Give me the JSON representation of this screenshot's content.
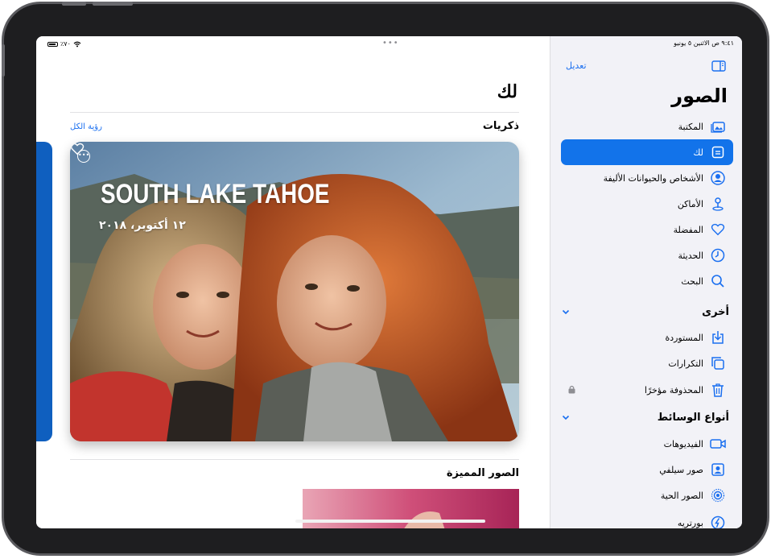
{
  "status": {
    "left_battery": "٪٧٠",
    "right_time": "٩:٤١ ص",
    "right_date": "الاثنين ٥ يونيو"
  },
  "main": {
    "title": "لك",
    "memories_title": "ذكريات",
    "see_all": "رؤية الكل",
    "card": {
      "title": "SOUTH LAKE TAHOE",
      "date": "١٢ أكتوبر، ٢٠١٨"
    },
    "featured_title": "الصور المميزة"
  },
  "sidebar": {
    "edit": "تعديل",
    "title": "الصور",
    "items": [
      {
        "label": "المكتبة",
        "icon": "photo-library-icon"
      },
      {
        "label": "لك",
        "icon": "for-you-icon"
      },
      {
        "label": "الأشخاص والحيوانات الأليفة",
        "icon": "person-circle-icon"
      },
      {
        "label": "الأماكن",
        "icon": "map-pin-icon"
      },
      {
        "label": "المفضلة",
        "icon": "heart-icon"
      },
      {
        "label": "الحديثة",
        "icon": "clock-icon"
      },
      {
        "label": "البحث",
        "icon": "search-icon"
      }
    ],
    "group_other": "أخرى",
    "other_items": [
      {
        "label": "المستوردة",
        "icon": "import-icon"
      },
      {
        "label": "التكرارات",
        "icon": "duplicates-icon"
      },
      {
        "label": "المحذوفة مؤخرًا",
        "icon": "trash-icon"
      }
    ],
    "group_media": "أنواع الوسائط",
    "media_items": [
      {
        "label": "الفيديوهات",
        "icon": "video-icon"
      },
      {
        "label": "صور سيلفي",
        "icon": "selfie-icon"
      },
      {
        "label": "الصور الحية",
        "icon": "live-photo-icon"
      },
      {
        "label": "بورتريه",
        "icon": "portrait-icon"
      }
    ]
  },
  "colors": {
    "accent": "#1273ea",
    "link": "#1a6ff0",
    "sidebar_bg": "#f2f2f7"
  }
}
